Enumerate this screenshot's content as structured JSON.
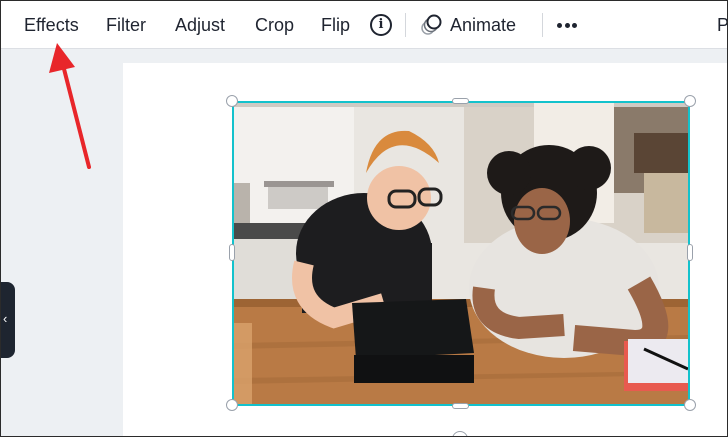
{
  "toolbar": {
    "effects": "Effects",
    "filter": "Filter",
    "adjust": "Adjust",
    "crop": "Crop",
    "flip": "Flip",
    "info": "i",
    "animate": "Animate",
    "more_icon": "more-horizontal-icon",
    "truncated_item": "P"
  },
  "sidebar": {
    "collapse_glyph": "‹"
  },
  "colors": {
    "selection": "#13c2cc",
    "annotation_arrow": "#e8262a",
    "side_tab": "#1e2530"
  }
}
